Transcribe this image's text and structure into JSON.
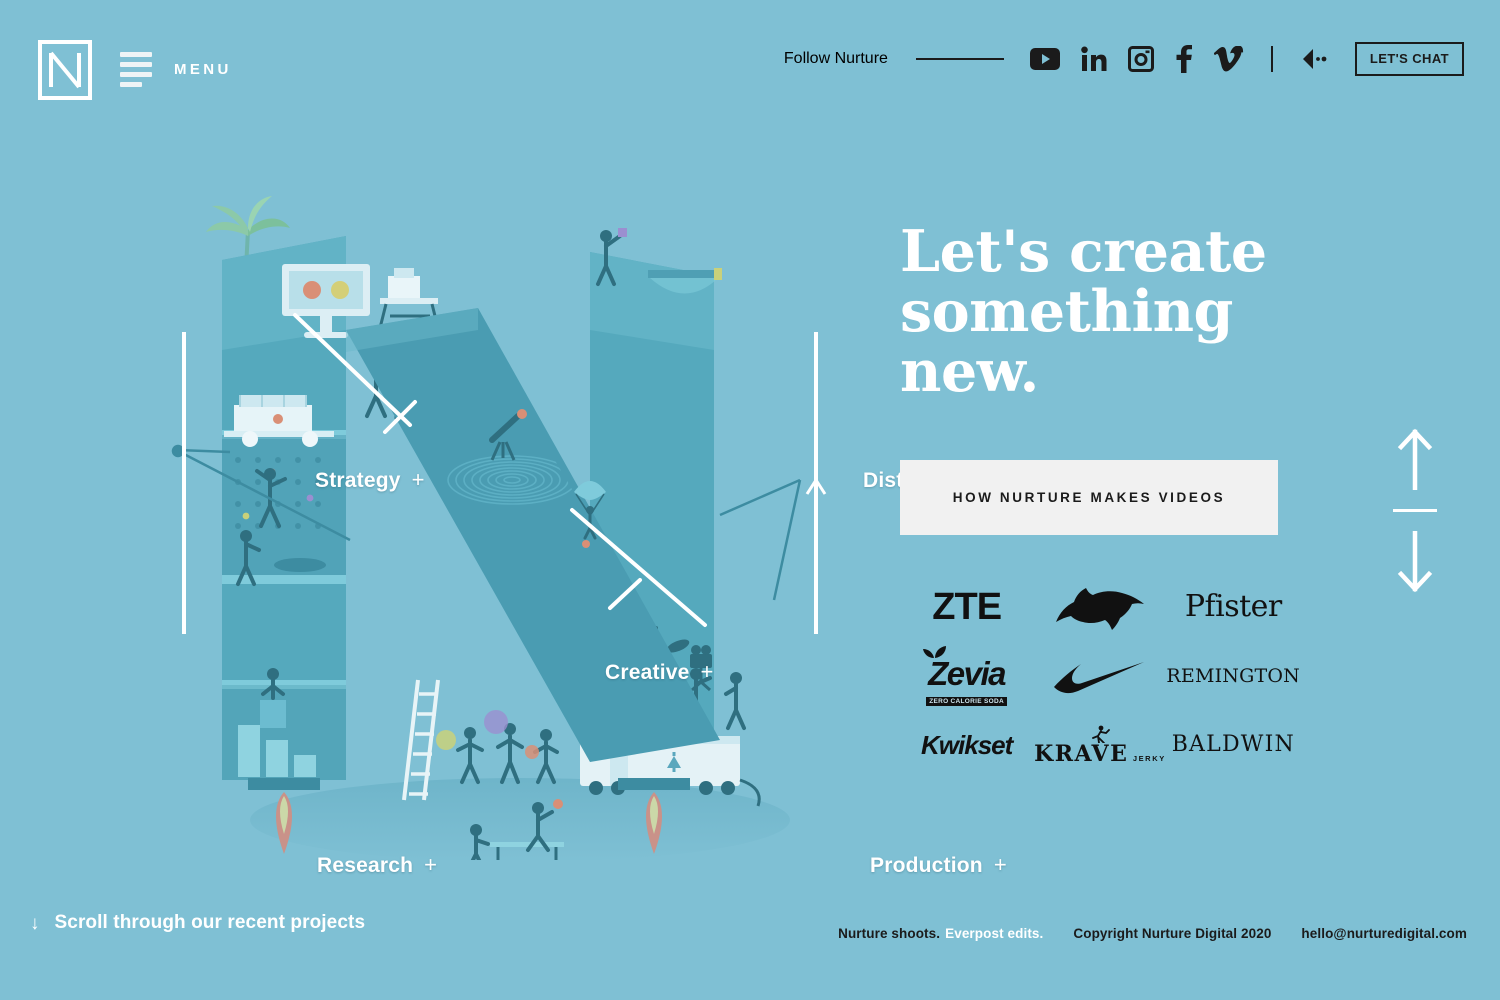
{
  "brand": {
    "logo_alt": "Nurture N logo"
  },
  "header": {
    "menu_label": "MENU",
    "follow_label": "Follow Nurture",
    "social": [
      {
        "name": "youtube-icon",
        "label": "YouTube"
      },
      {
        "name": "linkedin-icon",
        "label": "LinkedIn"
      },
      {
        "name": "instagram-icon",
        "label": "Instagram"
      },
      {
        "name": "facebook-icon",
        "label": "Facebook"
      },
      {
        "name": "vimeo-icon",
        "label": "Vimeo"
      }
    ],
    "sound_icon": "sound-on-icon",
    "chat_button": "LET'S CHAT"
  },
  "illustration": {
    "nodes": [
      {
        "label": "Strategy",
        "plus": "+"
      },
      {
        "label": "Distribution",
        "plus": "+"
      },
      {
        "label": "Creative",
        "plus": "+"
      },
      {
        "label": "Research",
        "plus": "+"
      },
      {
        "label": "Production",
        "plus": "+"
      }
    ]
  },
  "hero": {
    "headline_line1": "Let's create",
    "headline_line2": "something",
    "headline_line3": "new.",
    "cta_label": "HOW NURTURE MAKES VIDEOS"
  },
  "clients": {
    "rows": [
      [
        {
          "name": "zte",
          "text": "ZTE",
          "style": "wm-zte"
        },
        {
          "name": "puma",
          "text": "",
          "style": "mark"
        },
        {
          "name": "pfister",
          "text": "Pfister",
          "style": "wm-pfister"
        }
      ],
      [
        {
          "name": "zevia",
          "text": "Zevia",
          "sub": "ZERO CALORIE SODA",
          "style": "zevia"
        },
        {
          "name": "nike",
          "text": "",
          "style": "mark"
        },
        {
          "name": "remington",
          "text": "REMINGTON",
          "style": "wm-remington"
        }
      ],
      [
        {
          "name": "kwikset",
          "text": "Kwikset",
          "style": "wm-kwikset"
        },
        {
          "name": "krave",
          "text": "KRAVE",
          "sub": "JERKY",
          "style": "krave"
        },
        {
          "name": "baldwin",
          "text": "BALDWIN",
          "style": "wm-baldwin"
        }
      ]
    ]
  },
  "scroll_nav": {
    "up_icon": "arrow-up-icon",
    "down_icon": "arrow-down-icon"
  },
  "footer": {
    "scroll_arrow": "↓",
    "scroll_text": "Scroll through our recent projects",
    "credit_dark": "Nurture shoots.",
    "credit_light": "Everpost edits.",
    "copyright": "Copyright Nurture Digital 2020",
    "email": "hello@nurturedigital.com"
  },
  "colors": {
    "background": "#7fc0d4",
    "cta_bg": "#f1f1f1",
    "ink": "#1b1b1b",
    "white": "#ffffff"
  }
}
